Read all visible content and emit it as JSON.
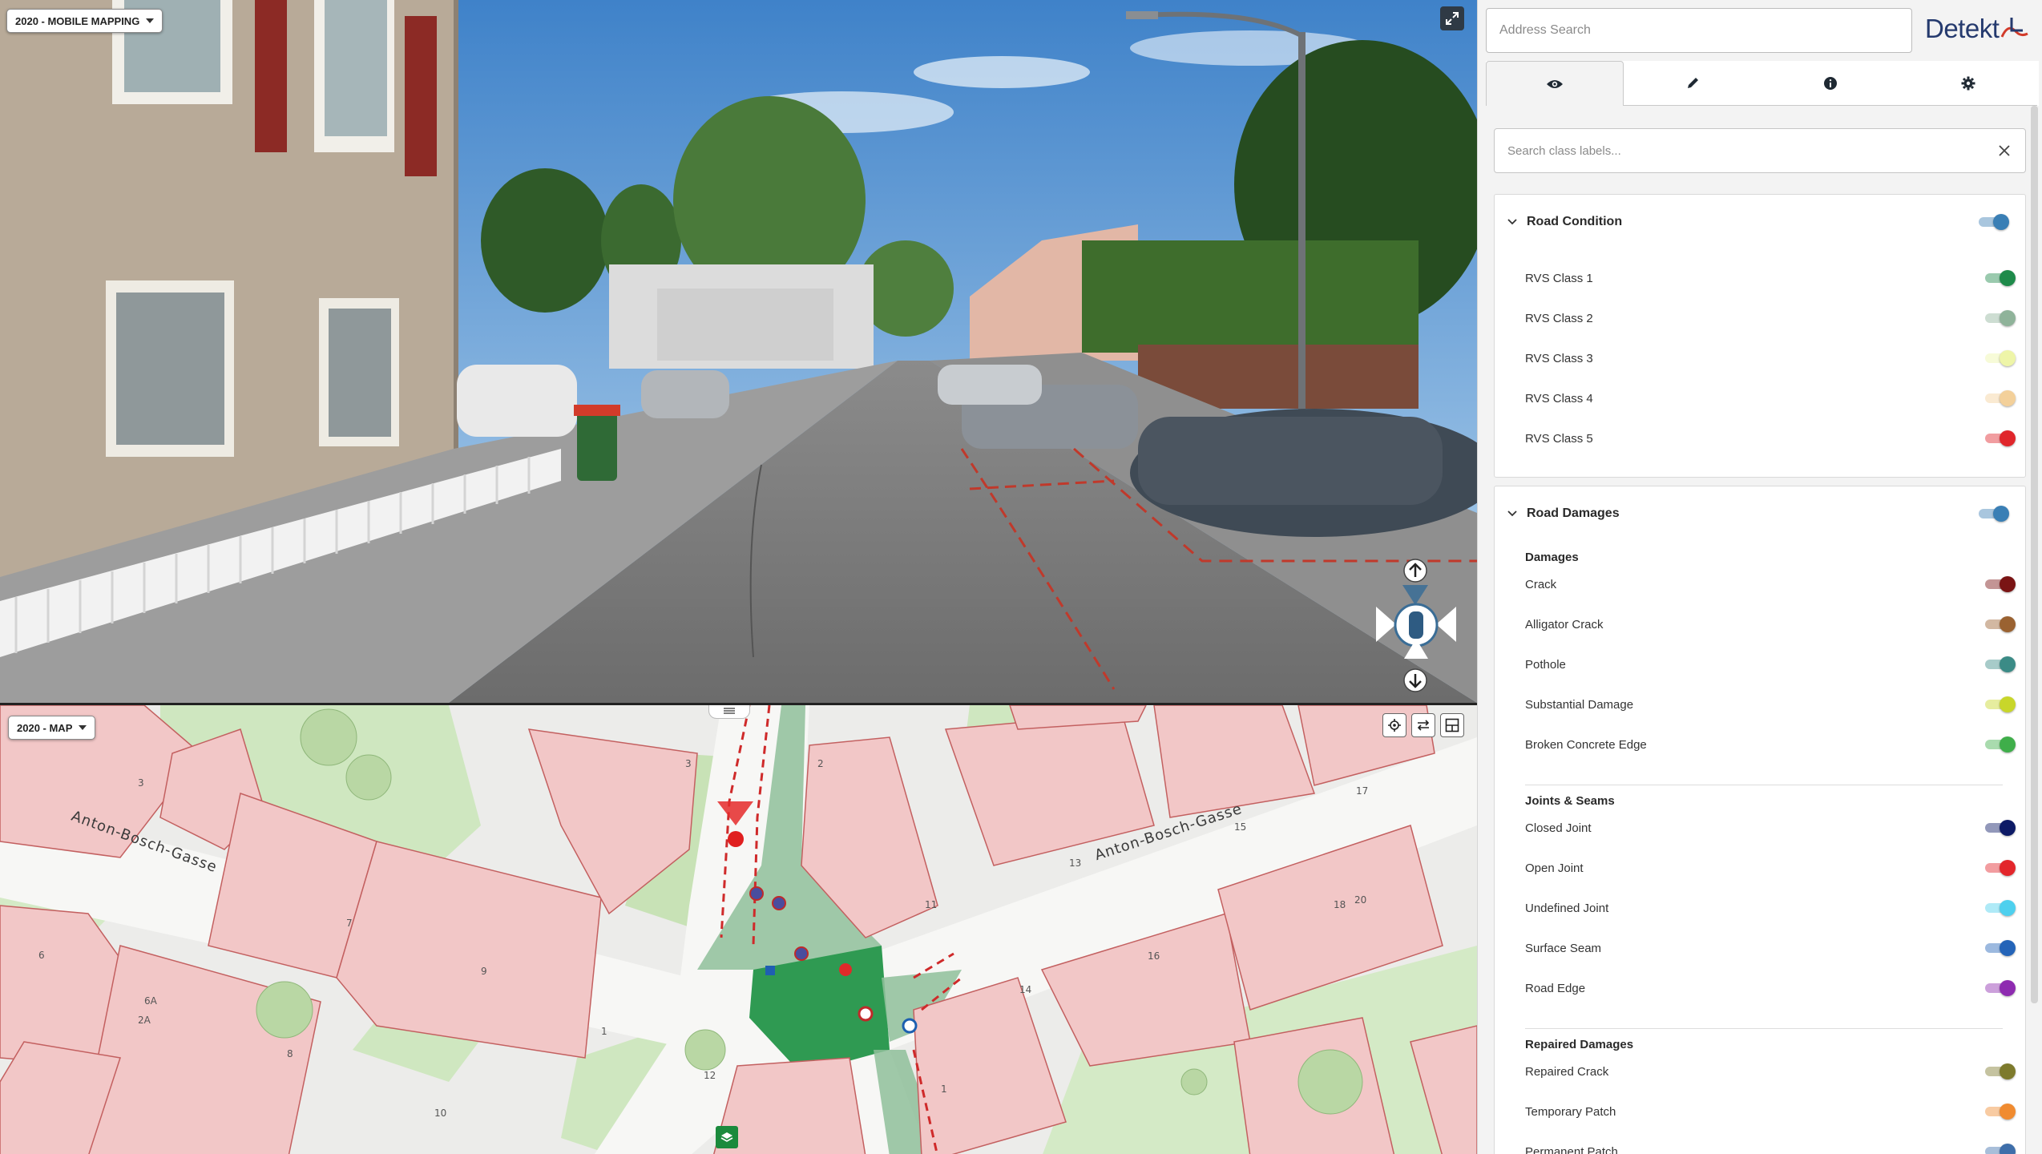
{
  "street_view": {
    "year_selector": "2020 - MOBILE MAPPING",
    "expand_icon": "expand-arrows-icon",
    "navigation": {
      "forward_icon": "arrow-up-icon",
      "back_icon": "arrow-down-icon",
      "vehicle_icon": "car-top-view-icon"
    }
  },
  "map": {
    "year_selector": "2020 - MAP",
    "tools": [
      {
        "name": "locate-tool",
        "icon": "crosshair-icon"
      },
      {
        "name": "swap-tool",
        "icon": "swap-arrows-icon"
      },
      {
        "name": "split-tool",
        "icon": "split-view-icon"
      }
    ],
    "layers_icon": "layers-icon",
    "streets": [
      "Anton-Bosch-Gasse",
      "Anton-Bosch-Gasse"
    ],
    "house_numbers": [
      "3",
      "7",
      "9",
      "6",
      "6A",
      "2A",
      "8",
      "10",
      "12",
      "1",
      "3",
      "2",
      "11",
      "13",
      "15",
      "17",
      "14",
      "16",
      "18",
      "20",
      "1"
    ]
  },
  "panel": {
    "address_placeholder": "Address Search",
    "logo_text": "Detekt",
    "tabs": [
      {
        "name": "tab-view",
        "icon": "eye-icon",
        "active": true
      },
      {
        "name": "tab-edit",
        "icon": "pencil-icon",
        "active": false
      },
      {
        "name": "tab-info",
        "icon": "info-icon",
        "active": false
      },
      {
        "name": "tab-settings",
        "icon": "gear-icon",
        "active": false
      }
    ],
    "class_search_placeholder": "Search class labels...",
    "road_condition": {
      "title": "Road Condition",
      "items": [
        {
          "label": "RVS Class 1",
          "color": "#1e8a4a"
        },
        {
          "label": "RVS Class 2",
          "color": "#8fb39a"
        },
        {
          "label": "RVS Class 3",
          "color": "#eef5a8"
        },
        {
          "label": "RVS Class 4",
          "color": "#f3d09a"
        },
        {
          "label": "RVS Class 5",
          "color": "#e0262b"
        }
      ]
    },
    "road_damages": {
      "title": "Road Damages",
      "groups": [
        {
          "title": "Damages",
          "items": [
            {
              "label": "Crack",
              "color": "#7a1414"
            },
            {
              "label": "Alligator Crack",
              "color": "#9a6231"
            },
            {
              "label": "Pothole",
              "color": "#3b8b86"
            },
            {
              "label": "Substantial Damage",
              "color": "#c8d62a"
            },
            {
              "label": "Broken Concrete Edge",
              "color": "#3fae4a"
            }
          ]
        },
        {
          "title": "Joints & Seams",
          "items": [
            {
              "label": "Closed Joint",
              "color": "#0d1a66"
            },
            {
              "label": "Open Joint",
              "color": "#e3262b"
            },
            {
              "label": "Undefined Joint",
              "color": "#4ed0ee"
            },
            {
              "label": "Surface Seam",
              "color": "#2464b8"
            },
            {
              "label": "Road Edge",
              "color": "#8e2bb0"
            }
          ]
        },
        {
          "title": "Repaired Damages",
          "items": [
            {
              "label": "Repaired Crack",
              "color": "#7d7a2c"
            },
            {
              "label": "Temporary Patch",
              "color": "#f08b30"
            },
            {
              "label": "Permanent Patch",
              "color": "#3e6eaa"
            }
          ]
        }
      ]
    },
    "header_toggle_color": "#3a7fb5"
  }
}
